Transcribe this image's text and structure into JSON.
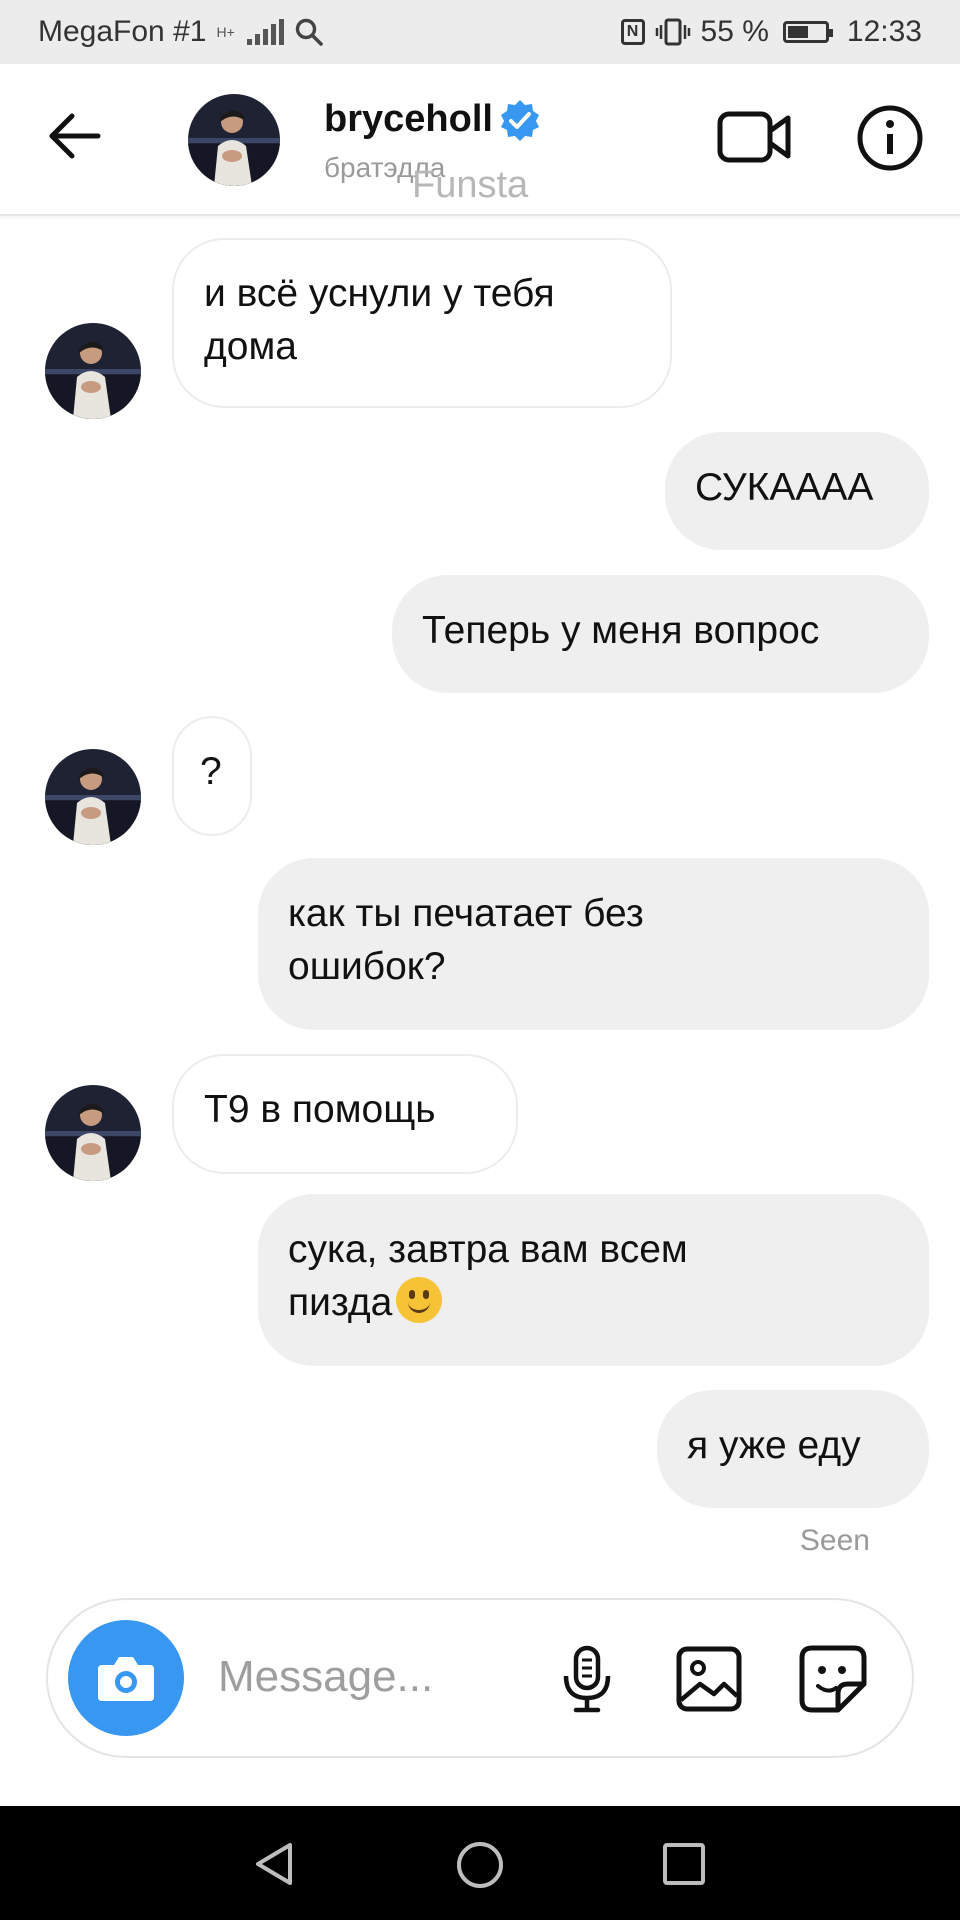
{
  "status_bar": {
    "carrier": "MegaFon #1",
    "network_type": "H+",
    "battery_percent": "55 %",
    "battery_level": 0.55,
    "time": "12:33"
  },
  "header": {
    "username": "bryceholl",
    "subtitle": "братэдла",
    "watermark": "Funsta"
  },
  "messages": [
    {
      "side": "received",
      "text": "и всё уснули у тебя\nдома"
    },
    {
      "side": "sent",
      "text": "СУКАААА"
    },
    {
      "side": "sent",
      "text": "Теперь у меня вопрос"
    },
    {
      "side": "received",
      "text": "?"
    },
    {
      "side": "sent",
      "text": "как ты печатает без\nошибок?"
    },
    {
      "side": "received",
      "text": "Т9 в помощь"
    },
    {
      "side": "sent",
      "text": "сука, завтра вам всем\nпизда"
    },
    {
      "side": "sent",
      "text": "я уже еду"
    }
  ],
  "seen_label": "Seen",
  "composer": {
    "placeholder": "Message..."
  },
  "colors": {
    "accent": "#3897f0",
    "sent_bubble": "#efefef",
    "received_bubble_border": "#ececec",
    "status_bar_bg": "#ececec",
    "nav_bar_bg": "#000000"
  },
  "icons": [
    "back-arrow-icon",
    "verified-badge-icon",
    "video-call-icon",
    "info-icon",
    "camera-icon",
    "microphone-icon",
    "gallery-icon",
    "sticker-icon",
    "nav-back-icon",
    "nav-home-icon",
    "nav-recents-icon",
    "smiley-emoji-icon"
  ]
}
